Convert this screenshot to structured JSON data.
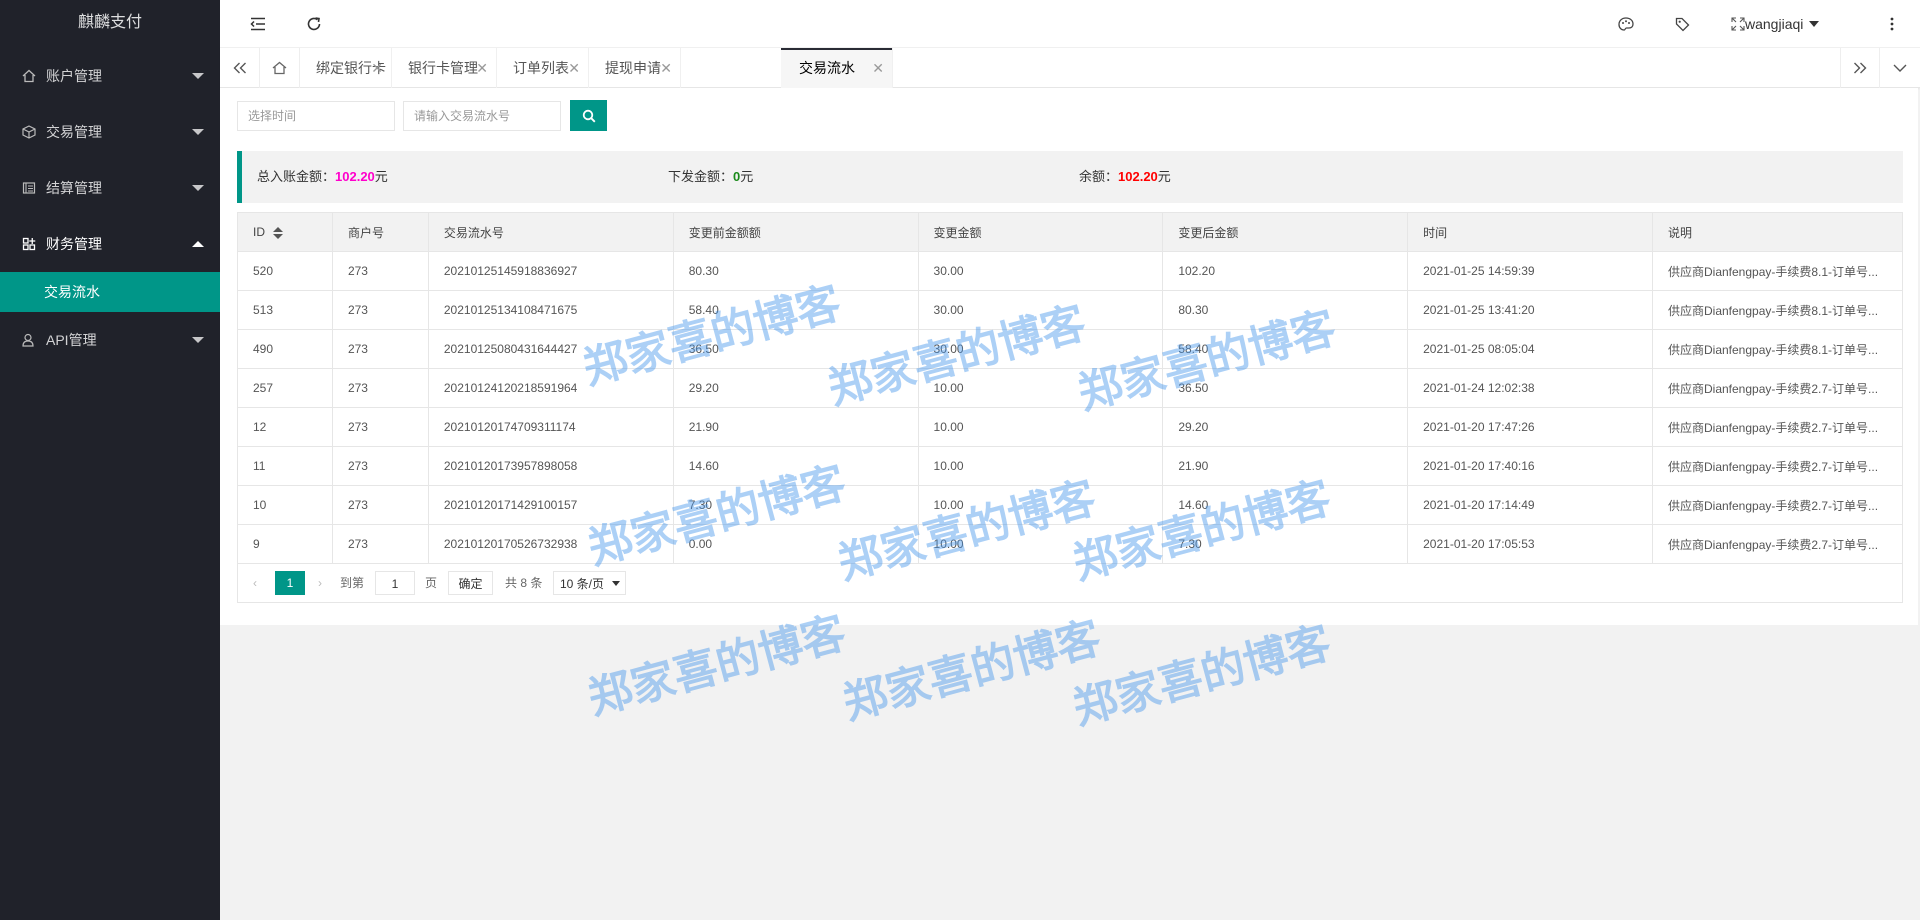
{
  "app": {
    "title": "麒麟支付"
  },
  "sidebar": {
    "groups": [
      {
        "label": "账户管理",
        "icon": "home-icon"
      },
      {
        "label": "交易管理",
        "icon": "cube-icon"
      },
      {
        "label": "结算管理",
        "icon": "document-icon"
      },
      {
        "label": "财务管理",
        "icon": "apps-icon",
        "expanded": true,
        "children": [
          {
            "label": "交易流水"
          }
        ]
      },
      {
        "label": "API管理",
        "icon": "user-icon"
      }
    ]
  },
  "header": {
    "username": "wangjiaqi"
  },
  "tabs": [
    {
      "label": "绑定银行卡"
    },
    {
      "label": "银行卡管理"
    },
    {
      "label": "订单列表"
    },
    {
      "label": "提现申请"
    },
    {
      "label": "交易流水",
      "active": true
    }
  ],
  "filters": {
    "time_placeholder": "选择时间",
    "serial_placeholder": "请输入交易流水号"
  },
  "summary": {
    "income_label": "总入账金额：",
    "income_value": "102.20",
    "payout_label": "下发金额：",
    "payout_value": "0",
    "balance_label": "余额：",
    "balance_value": "102.20",
    "unit": "元",
    "colors": {
      "income": "#ff00cc",
      "payout": "#1a8a1a",
      "balance": "#ff0000"
    }
  },
  "table": {
    "columns": [
      "ID",
      "商户号",
      "交易流水号",
      "变更前金额额",
      "变更金额",
      "变更后金额",
      "时间",
      "说明"
    ],
    "rows": [
      [
        "520",
        "273",
        "20210125145918836927",
        "80.30",
        "30.00",
        "102.20",
        "2021-01-25 14:59:39",
        "供应商Dianfengpay-手续费8.1-订单号..."
      ],
      [
        "513",
        "273",
        "20210125134108471675",
        "58.40",
        "30.00",
        "80.30",
        "2021-01-25 13:41:20",
        "供应商Dianfengpay-手续费8.1-订单号..."
      ],
      [
        "490",
        "273",
        "20210125080431644427",
        "36.50",
        "30.00",
        "58.40",
        "2021-01-25 08:05:04",
        "供应商Dianfengpay-手续费8.1-订单号..."
      ],
      [
        "257",
        "273",
        "20210124120218591964",
        "29.20",
        "10.00",
        "36.50",
        "2021-01-24 12:02:38",
        "供应商Dianfengpay-手续费2.7-订单号..."
      ],
      [
        "12",
        "273",
        "20210120174709311174",
        "21.90",
        "10.00",
        "29.20",
        "2021-01-20 17:47:26",
        "供应商Dianfengpay-手续费2.7-订单号..."
      ],
      [
        "11",
        "273",
        "20210120173957898058",
        "14.60",
        "10.00",
        "21.90",
        "2021-01-20 17:40:16",
        "供应商Dianfengpay-手续费2.7-订单号..."
      ],
      [
        "10",
        "273",
        "20210120171429100157",
        "7.30",
        "10.00",
        "14.60",
        "2021-01-20 17:14:49",
        "供应商Dianfengpay-手续费2.7-订单号..."
      ],
      [
        "9",
        "273",
        "20210120170526732938",
        "0.00",
        "10.00",
        "7.30",
        "2021-01-20 17:05:53",
        "供应商Dianfengpay-手续费2.7-订单号..."
      ]
    ]
  },
  "pagination": {
    "current_page": "1",
    "goto_label": "到第",
    "goto_value": "1",
    "page_label": "页",
    "confirm_label": "确定",
    "total_label": "共 8 条",
    "page_size": "10 条/页"
  },
  "watermark": {
    "text": "郑家喜的博客"
  }
}
